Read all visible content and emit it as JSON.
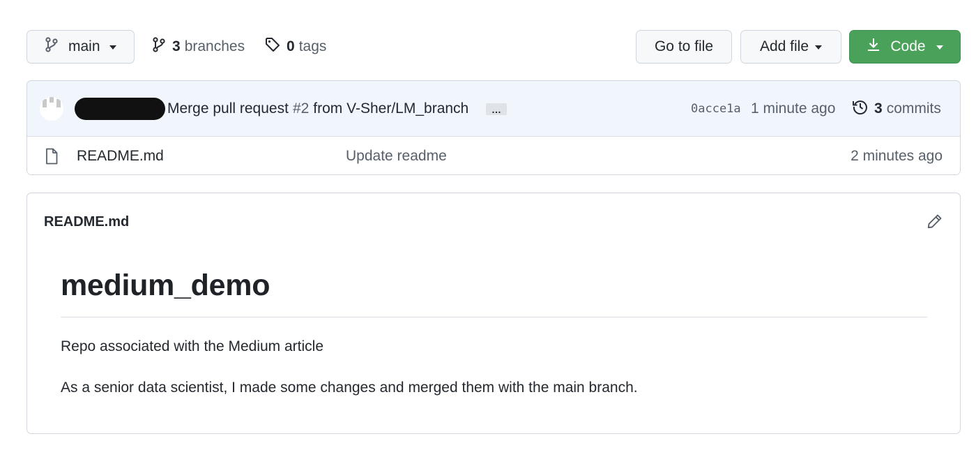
{
  "toolbar": {
    "branch_button": {
      "label": "main",
      "icon": "git-branch-icon"
    },
    "branches": {
      "count": "3",
      "label": "branches",
      "icon": "git-branch-icon"
    },
    "tags": {
      "count": "0",
      "label": "tags",
      "icon": "tag-icon"
    },
    "go_to_file": "Go to file",
    "add_file": "Add file",
    "code": {
      "label": "Code",
      "icon": "download-icon",
      "color": "#4aa15a"
    }
  },
  "latest_commit": {
    "author_redacted": true,
    "message_prefix": "Merge pull request",
    "pr_number": "#2",
    "message_suffix": "from V-Sher/LM_branch",
    "ellipsis": "…",
    "sha": "0acce1a",
    "time": "1 minute ago",
    "history": {
      "count": "3",
      "label": "commits",
      "icon": "history-icon"
    }
  },
  "files": [
    {
      "icon": "file-icon",
      "name": "README.md",
      "commit_message": "Update readme",
      "time": "2 minutes ago"
    }
  ],
  "readme": {
    "header": "README.md",
    "edit_icon": "pencil-icon",
    "title": "medium_demo",
    "paragraphs": [
      "Repo associated with the Medium article",
      "As a senior data scientist, I made some changes and merged them with the main branch."
    ]
  }
}
